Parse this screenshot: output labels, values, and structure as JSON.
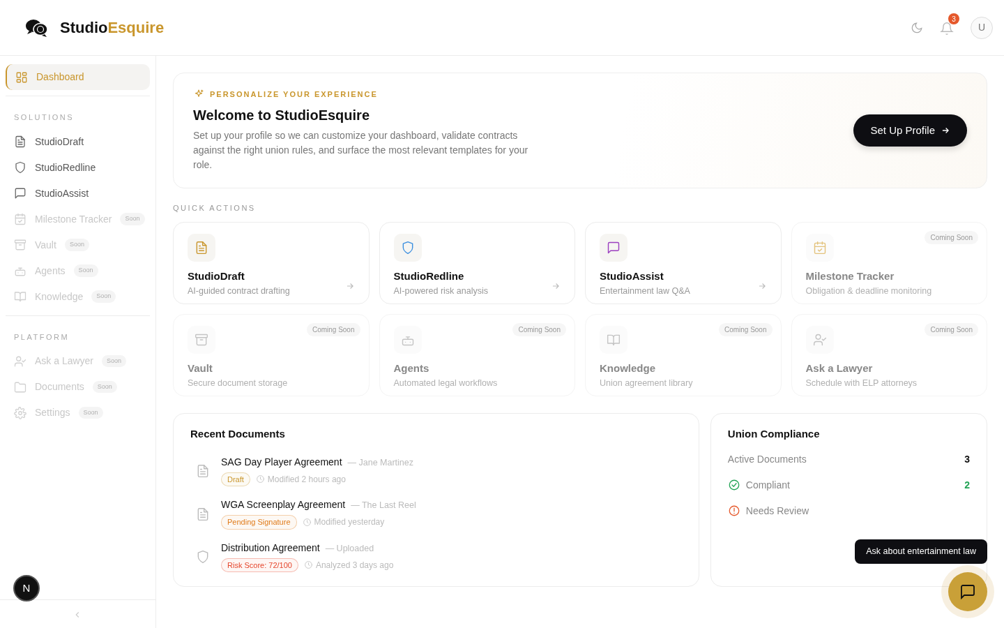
{
  "header": {
    "logo_first": "Studio",
    "logo_second": "Esquire",
    "notifications": "3",
    "avatar": "U"
  },
  "sidebar": {
    "items": [
      {
        "label": "Dashboard",
        "selected": true,
        "disabled": false
      }
    ],
    "sections": [
      {
        "title": "SOLUTIONS",
        "items": [
          {
            "label": "StudioDraft",
            "selected": false,
            "disabled": false
          },
          {
            "label": "StudioRedline",
            "selected": false,
            "disabled": false
          },
          {
            "label": "StudioAssist",
            "selected": false,
            "disabled": false
          },
          {
            "label": "Milestone Tracker",
            "selected": false,
            "disabled": true,
            "badge": "Soon"
          },
          {
            "label": "Vault",
            "selected": false,
            "disabled": true,
            "badge": "Soon"
          },
          {
            "label": "Agents",
            "selected": false,
            "disabled": true,
            "badge": "Soon"
          },
          {
            "label": "Knowledge",
            "selected": false,
            "disabled": true,
            "badge": "Soon"
          }
        ]
      },
      {
        "title": "PLATFORM",
        "items": [
          {
            "label": "Ask a Lawyer",
            "selected": false,
            "disabled": true,
            "badge": "Soon"
          },
          {
            "label": "Documents",
            "selected": false,
            "disabled": true,
            "badge": "Soon"
          },
          {
            "label": "Settings",
            "selected": false,
            "disabled": true,
            "badge": "Soon"
          }
        ]
      }
    ],
    "dev_indicator": "N"
  },
  "welcome": {
    "eyebrow": "PERSONALIZE YOUR EXPERIENCE",
    "title": "Welcome to StudioEsquire",
    "text": "Set up your profile so we can customize your dashboard, validate contracts against the right union rules, and surface the most relevant templates for your role.",
    "button": "Set Up Profile"
  },
  "quick_actions": {
    "title": "QUICK ACTIONS",
    "cards": [
      {
        "title": "StudioDraft",
        "subtitle": "AI-guided contract drafting",
        "disabled": false,
        "color": "#c9962c"
      },
      {
        "title": "StudioRedline",
        "subtitle": "AI-powered risk analysis",
        "disabled": false,
        "color": "#3b8fe0"
      },
      {
        "title": "StudioAssist",
        "subtitle": "Entertainment law Q&A",
        "disabled": false,
        "color": "#9b3fc0"
      },
      {
        "title": "Milestone Tracker",
        "subtitle": "Obligation & deadline monitoring",
        "disabled": true,
        "badge": "Coming Soon",
        "color": "#e3c27c"
      },
      {
        "title": "Vault",
        "subtitle": "Secure document storage",
        "disabled": true,
        "badge": "Coming Soon",
        "color": "#c4c4c4"
      },
      {
        "title": "Agents",
        "subtitle": "Automated legal workflows",
        "disabled": true,
        "badge": "Coming Soon",
        "color": "#c4c4c4"
      },
      {
        "title": "Knowledge",
        "subtitle": "Union agreement library",
        "disabled": true,
        "badge": "Coming Soon",
        "color": "#c4c4c4"
      },
      {
        "title": "Ask a Lawyer",
        "subtitle": "Schedule with ELP attorneys",
        "disabled": true,
        "badge": "Coming Soon",
        "color": "#c4c4c4"
      }
    ]
  },
  "recent_documents": {
    "title": "Recent Documents",
    "rows": [
      {
        "kind": "document",
        "name": "SAG Day Player Agreement",
        "party": "— Jane Martinez",
        "status": "Draft",
        "color": "#c9962c",
        "time": "Modified 2 hours ago"
      },
      {
        "kind": "document",
        "name": "WGA Screenplay Agreement",
        "party": "— The Last Reel",
        "status": "Pending Signature",
        "color": "#e07b1a",
        "time": "Modified yesterday"
      },
      {
        "kind": "shield",
        "name": "Distribution Agreement",
        "party": "— Uploaded",
        "status": "Risk Score: 72/100",
        "color": "#e5452b",
        "time": "Analyzed 3 days ago"
      }
    ]
  },
  "union_compliance": {
    "title": "Union Compliance",
    "rows": [
      {
        "kind": "plain",
        "label": "Active Documents",
        "value": "3"
      },
      {
        "kind": "check",
        "label": "Compliant",
        "value": "2",
        "color": "#22a355"
      },
      {
        "kind": "alert",
        "label": "Needs Review",
        "color": "#e5582b"
      }
    ]
  },
  "chat": {
    "tooltip": "Ask about entertainment law"
  }
}
